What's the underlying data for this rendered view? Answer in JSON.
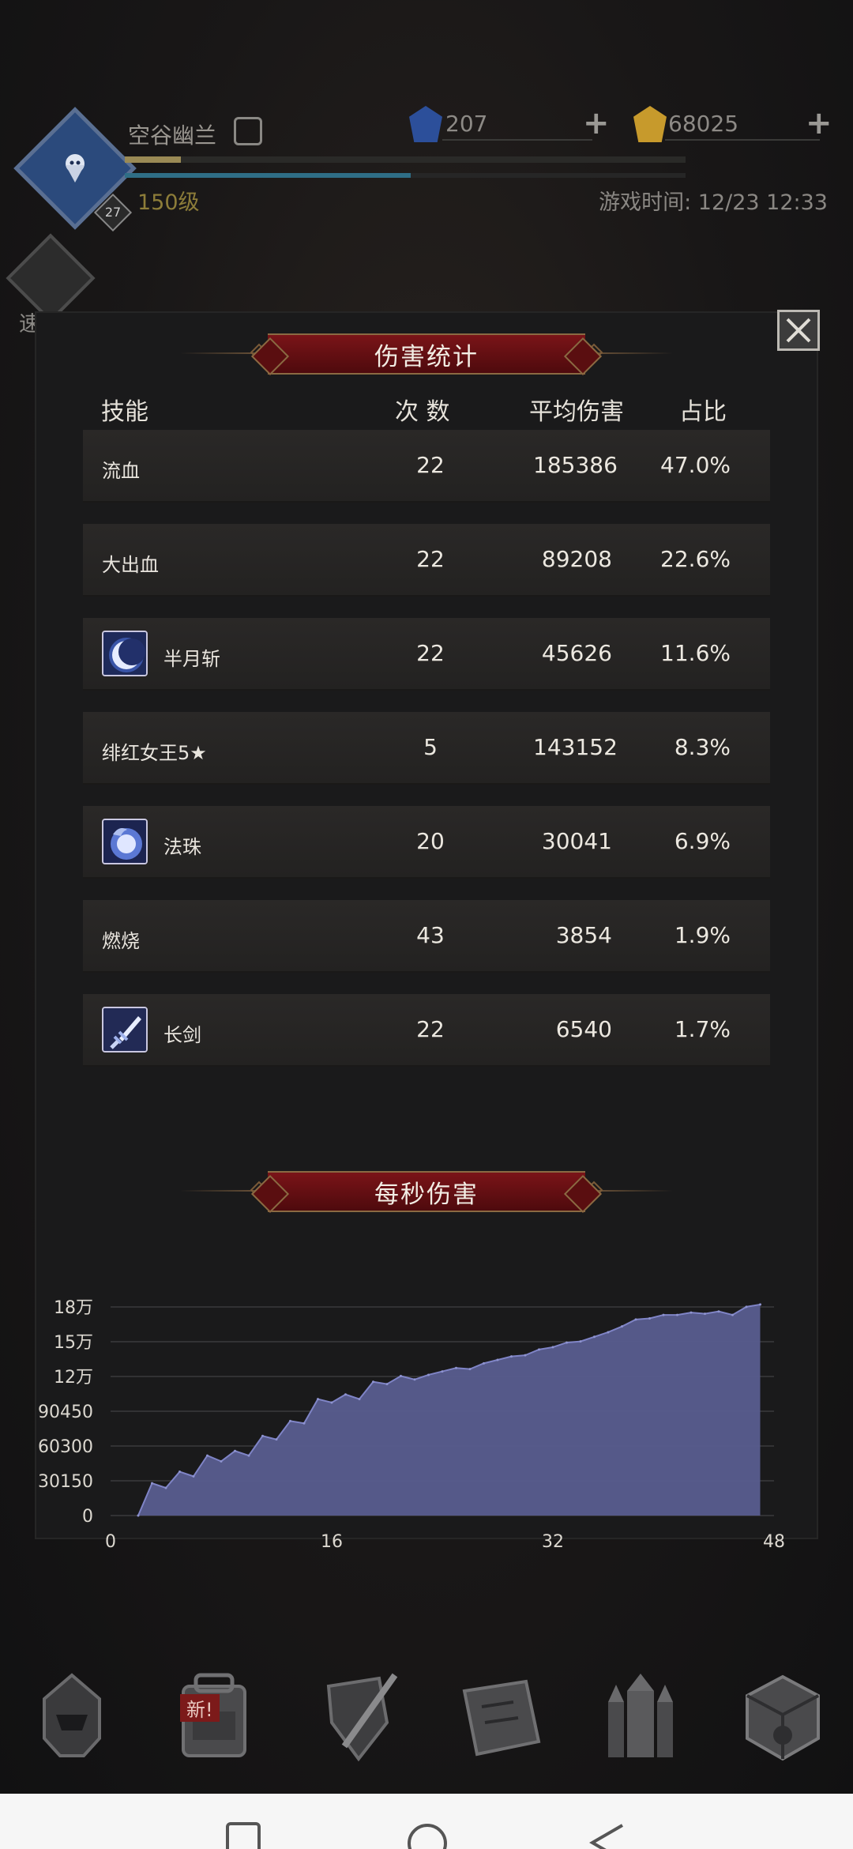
{
  "hud": {
    "player_name": "空谷幽兰",
    "player_level": "150级",
    "level_badge": "27",
    "gems": "207",
    "gold": "68025",
    "game_time": "游戏时间: 12/23 12:33",
    "quick_battle": "速战",
    "xp_progress": 0.1,
    "hp_progress": 0.51
  },
  "dialog": {
    "title": "伤害统计",
    "columns": {
      "skill": "技能",
      "count": "次 数",
      "avg_damage": "平均伤害",
      "share": "占比"
    },
    "rows": [
      {
        "name": "流血",
        "count": "22",
        "avg": "185386",
        "pct": "47.0%",
        "icon": ""
      },
      {
        "name": "大出血",
        "count": "22",
        "avg": "89208",
        "pct": "22.6%",
        "icon": ""
      },
      {
        "name": "半月斩",
        "count": "22",
        "avg": "45626",
        "pct": "11.6%",
        "icon": "crescent-slash-icon"
      },
      {
        "name": "绯红女王5★",
        "count": "5",
        "avg": "143152",
        "pct": "8.3%",
        "icon": ""
      },
      {
        "name": "法珠",
        "count": "20",
        "avg": "30041",
        "pct": "6.9%",
        "icon": "magic-orb-icon"
      },
      {
        "name": "燃烧",
        "count": "43",
        "avg": "3854",
        "pct": "1.9%",
        "icon": ""
      },
      {
        "name": "长剑",
        "count": "22",
        "avg": "6540",
        "pct": "1.7%",
        "icon": "longsword-icon"
      }
    ],
    "dps_title": "每秒伤害",
    "close_icon": "close-icon"
  },
  "chart_data": {
    "type": "area",
    "title": "每秒伤害",
    "xlabel": "",
    "ylabel": "",
    "x_ticks": [
      "0",
      "16",
      "32",
      "48"
    ],
    "y_ticks": [
      "0",
      "30150",
      "60300",
      "90450",
      "12万",
      "15万",
      "18万"
    ],
    "xlim": [
      0,
      48
    ],
    "ylim": [
      0,
      180900
    ],
    "grid": true,
    "color": "#5a5e92",
    "x": [
      2,
      3,
      4,
      5,
      6,
      7,
      8,
      9,
      10,
      11,
      12,
      13,
      14,
      15,
      16,
      17,
      18,
      19,
      20,
      21,
      22,
      23,
      24,
      25,
      26,
      27,
      28,
      29,
      30,
      31,
      32,
      33,
      34,
      35,
      36,
      37,
      38,
      39,
      40,
      41,
      42,
      43,
      44,
      45,
      46,
      47
    ],
    "values": [
      0,
      28000,
      24000,
      38000,
      34000,
      52000,
      47000,
      56000,
      52000,
      69000,
      66000,
      82000,
      80000,
      101000,
      98000,
      105000,
      101000,
      116000,
      114000,
      121000,
      118000,
      122000,
      125000,
      128000,
      127000,
      132000,
      135000,
      138000,
      139000,
      144000,
      146000,
      150000,
      151000,
      155000,
      159000,
      164000,
      170000,
      171000,
      174000,
      174000,
      176000,
      175000,
      177000,
      174000,
      181000,
      183000
    ]
  },
  "nav": {
    "new_badge": "新!"
  }
}
